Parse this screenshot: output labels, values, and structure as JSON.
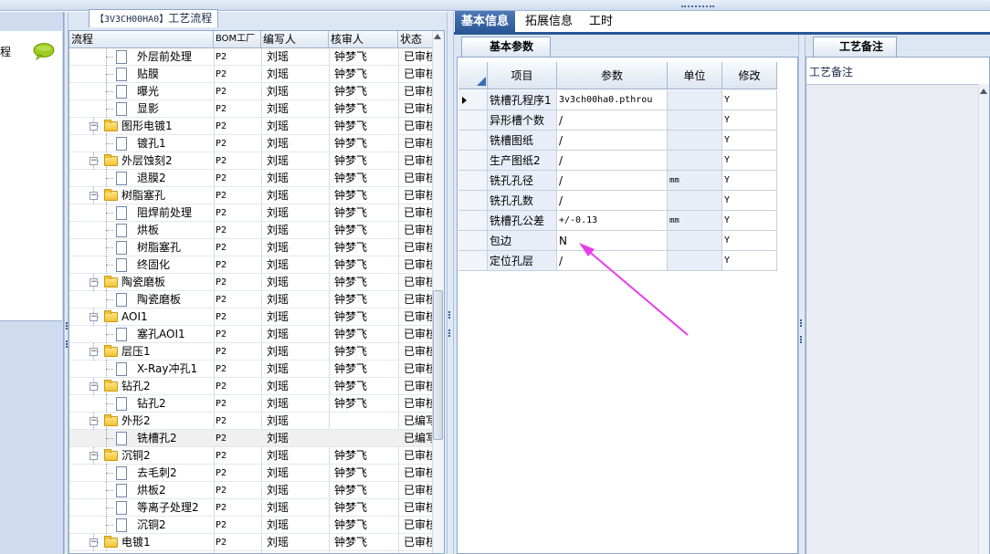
{
  "left_panel": {
    "label": "程"
  },
  "tree_panel": {
    "title_code": "【3V3CH00HA0】",
    "title_text": "工艺流程",
    "columns": {
      "flow": "流程",
      "bom": "BOM工厂",
      "writer": "编写人",
      "reviewer": "核审人",
      "status": "状态"
    },
    "rows": [
      {
        "label": "外层前处理",
        "level": 1,
        "folder": false,
        "bom": "P2",
        "writer": "刘瑶",
        "reviewer": "钟梦飞",
        "status": "已审核"
      },
      {
        "label": "贴膜",
        "level": 1,
        "folder": false,
        "bom": "P2",
        "writer": "刘瑶",
        "reviewer": "钟梦飞",
        "status": "已审核"
      },
      {
        "label": "曝光",
        "level": 1,
        "folder": false,
        "bom": "P2",
        "writer": "刘瑶",
        "reviewer": "钟梦飞",
        "status": "已审核"
      },
      {
        "label": "显影",
        "level": 1,
        "folder": false,
        "bom": "P2",
        "writer": "刘瑶",
        "reviewer": "钟梦飞",
        "status": "已审核"
      },
      {
        "label": "图形电镀1",
        "level": 0,
        "folder": true,
        "bom": "P2",
        "writer": "刘瑶",
        "reviewer": "钟梦飞",
        "status": "已审核"
      },
      {
        "label": "镀孔1",
        "level": 1,
        "folder": false,
        "bom": "P2",
        "writer": "刘瑶",
        "reviewer": "钟梦飞",
        "status": "已审核"
      },
      {
        "label": "外层蚀刻2",
        "level": 0,
        "folder": true,
        "bom": "P2",
        "writer": "刘瑶",
        "reviewer": "钟梦飞",
        "status": "已审核"
      },
      {
        "label": "退膜2",
        "level": 1,
        "folder": false,
        "bom": "P2",
        "writer": "刘瑶",
        "reviewer": "钟梦飞",
        "status": "已审核"
      },
      {
        "label": "树脂塞孔",
        "level": 0,
        "folder": true,
        "bom": "P2",
        "writer": "刘瑶",
        "reviewer": "钟梦飞",
        "status": "已审核"
      },
      {
        "label": "阻焊前处理",
        "level": 1,
        "folder": false,
        "bom": "P2",
        "writer": "刘瑶",
        "reviewer": "钟梦飞",
        "status": "已审核"
      },
      {
        "label": "烘板",
        "level": 1,
        "folder": false,
        "bom": "P2",
        "writer": "刘瑶",
        "reviewer": "钟梦飞",
        "status": "已审核"
      },
      {
        "label": "树脂塞孔",
        "level": 1,
        "folder": false,
        "bom": "P2",
        "writer": "刘瑶",
        "reviewer": "钟梦飞",
        "status": "已审核"
      },
      {
        "label": "终固化",
        "level": 1,
        "folder": false,
        "bom": "P2",
        "writer": "刘瑶",
        "reviewer": "钟梦飞",
        "status": "已审核"
      },
      {
        "label": "陶瓷磨板",
        "level": 0,
        "folder": true,
        "bom": "P2",
        "writer": "刘瑶",
        "reviewer": "钟梦飞",
        "status": "已审核"
      },
      {
        "label": "陶瓷磨板",
        "level": 1,
        "folder": false,
        "bom": "P2",
        "writer": "刘瑶",
        "reviewer": "钟梦飞",
        "status": "已审核"
      },
      {
        "label": "AOI1",
        "level": 0,
        "folder": true,
        "bom": "P2",
        "writer": "刘瑶",
        "reviewer": "钟梦飞",
        "status": "已审核"
      },
      {
        "label": "塞孔AOI1",
        "level": 1,
        "folder": false,
        "bom": "P2",
        "writer": "刘瑶",
        "reviewer": "钟梦飞",
        "status": "已审核"
      },
      {
        "label": "层压1",
        "level": 0,
        "folder": true,
        "bom": "P2",
        "writer": "刘瑶",
        "reviewer": "钟梦飞",
        "status": "已审核"
      },
      {
        "label": "X-Ray冲孔1",
        "level": 1,
        "folder": false,
        "bom": "P2",
        "writer": "刘瑶",
        "reviewer": "钟梦飞",
        "status": "已审核"
      },
      {
        "label": "钻孔2",
        "level": 0,
        "folder": true,
        "bom": "P2",
        "writer": "刘瑶",
        "reviewer": "钟梦飞",
        "status": "已审核"
      },
      {
        "label": "钻孔2",
        "level": 1,
        "folder": false,
        "bom": "P2",
        "writer": "刘瑶",
        "reviewer": "钟梦飞",
        "status": "已审核"
      },
      {
        "label": "外形2",
        "level": 0,
        "folder": true,
        "bom": "P2",
        "writer": "刘瑶",
        "reviewer": "",
        "status": "已编写"
      },
      {
        "label": "铣槽孔2",
        "level": 1,
        "folder": false,
        "bom": "P2",
        "writer": "刘瑶",
        "reviewer": "",
        "status": "已编写",
        "selected": true
      },
      {
        "label": "沉铜2",
        "level": 0,
        "folder": true,
        "bom": "P2",
        "writer": "刘瑶",
        "reviewer": "钟梦飞",
        "status": "已审核"
      },
      {
        "label": "去毛刺2",
        "level": 1,
        "folder": false,
        "bom": "P2",
        "writer": "刘瑶",
        "reviewer": "钟梦飞",
        "status": "已审核"
      },
      {
        "label": "烘板2",
        "level": 1,
        "folder": false,
        "bom": "P2",
        "writer": "刘瑶",
        "reviewer": "钟梦飞",
        "status": "已审核"
      },
      {
        "label": "等离子处理2",
        "level": 1,
        "folder": false,
        "bom": "P2",
        "writer": "刘瑶",
        "reviewer": "钟梦飞",
        "status": "已审核"
      },
      {
        "label": "沉铜2",
        "level": 1,
        "folder": false,
        "bom": "P2",
        "writer": "刘瑶",
        "reviewer": "钟梦飞",
        "status": "已审核"
      },
      {
        "label": "电镀1",
        "level": 0,
        "folder": true,
        "bom": "P2",
        "writer": "刘瑶",
        "reviewer": "钟梦飞",
        "status": "已审核"
      }
    ]
  },
  "tabs": [
    {
      "label": "基本信息",
      "active": true
    },
    {
      "label": "拓展信息",
      "active": false
    },
    {
      "label": "工时",
      "active": false
    }
  ],
  "basic_params": {
    "subtab": "基本参数",
    "columns": {
      "item": "项目",
      "param": "参数",
      "unit": "单位",
      "modify": "修改"
    },
    "rows": [
      {
        "name": "铣槽孔程序1",
        "value": "3v3ch00ha0.pthrou",
        "unit": "",
        "modify": "Y",
        "current": true
      },
      {
        "name": "异形槽个数",
        "value": "/",
        "unit": "",
        "modify": "Y"
      },
      {
        "name": "铣槽图纸",
        "value": "/",
        "unit": "",
        "modify": "Y"
      },
      {
        "name": "生产图纸2",
        "value": "/",
        "unit": "",
        "modify": "Y"
      },
      {
        "name": "铣孔孔径",
        "value": "/",
        "unit": "mm",
        "modify": "Y"
      },
      {
        "name": "铣孔孔数",
        "value": "/",
        "unit": "",
        "modify": "Y"
      },
      {
        "name": "铣槽孔公差",
        "value": "+/-0.13",
        "unit": "mm",
        "modify": "Y"
      },
      {
        "name": "包边",
        "value": "N",
        "unit": "",
        "modify": "Y"
      },
      {
        "name": "定位孔层",
        "value": "/",
        "unit": "",
        "modify": "Y"
      }
    ]
  },
  "notes_panel": {
    "subtab": "工艺备注",
    "label": "工艺备注"
  },
  "annotation": {
    "arrow_color": "#e83ce8"
  }
}
